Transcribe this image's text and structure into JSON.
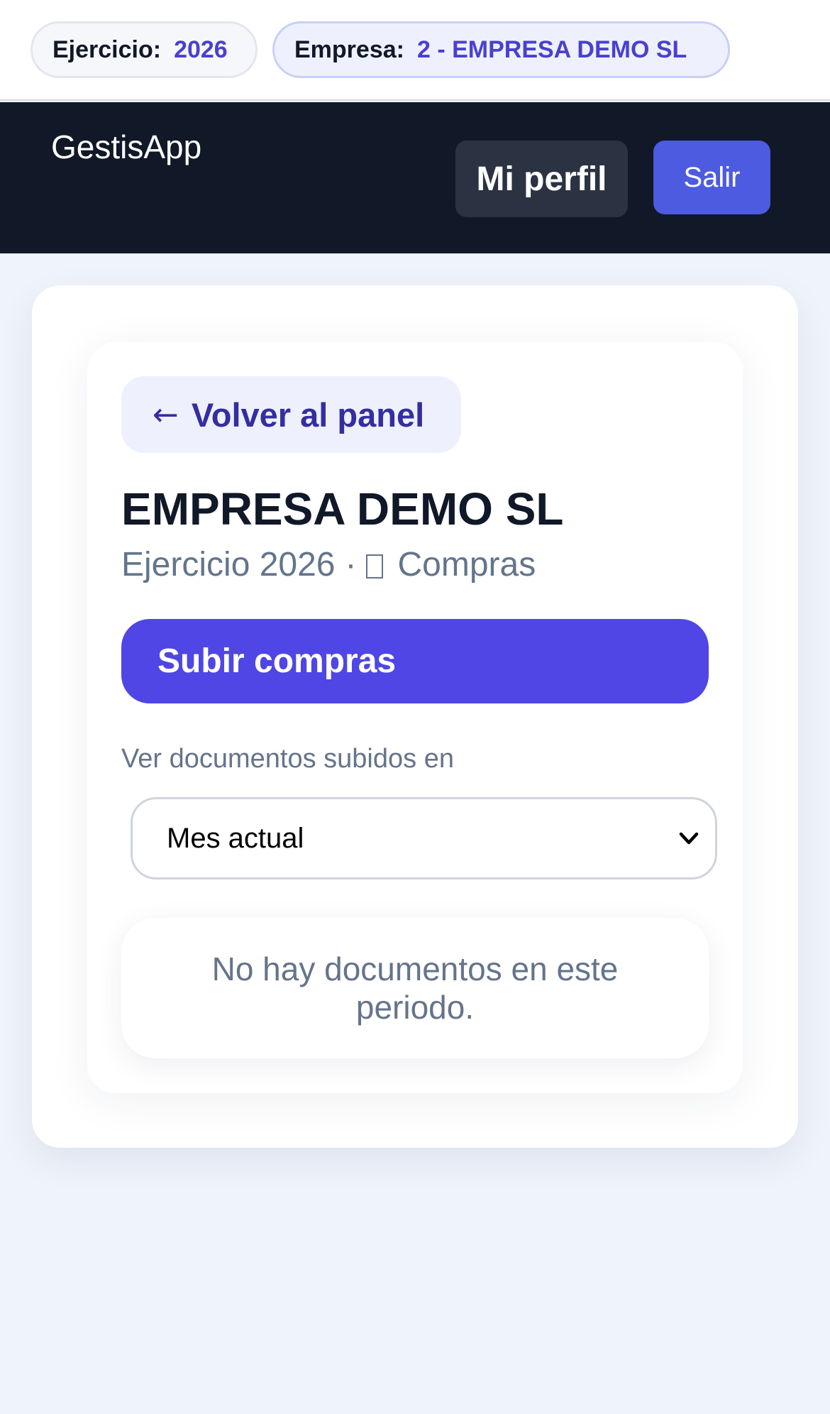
{
  "context": {
    "ejercicio_label": "Ejercicio:",
    "ejercicio_value": "2026",
    "empresa_label": "Empresa:",
    "empresa_value": "2 - EMPRESA DEMO SL"
  },
  "nav": {
    "brand": "GestisApp",
    "profile_label": "Mi perfil",
    "logout_label": "Salir"
  },
  "page": {
    "back_label": "Volver al panel",
    "back_arrow": "←",
    "company_name": "EMPRESA DEMO SL",
    "subtitle_year": "Ejercicio 2026",
    "subtitle_separator": "·",
    "subtitle_section": "Compras",
    "upload_label": "Subir compras",
    "period_label": "Ver documentos subidos en",
    "period_selected": "Mes actual",
    "empty_message": "No hay documentos en este periodo."
  },
  "colors": {
    "accent": "#4f46e5",
    "nav_background": "#111827",
    "logout_button": "#4c5be0",
    "page_background": "#eff3fb"
  }
}
